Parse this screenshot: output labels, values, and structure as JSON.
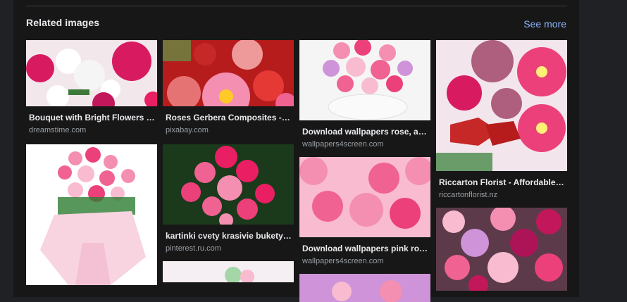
{
  "section": {
    "title": "Related images",
    "see_more": "See more"
  },
  "cards": [
    {
      "title": "Bouquet with Bright Flowers . ...",
      "source": "dreamstime.com"
    },
    {
      "title": "Roses Gerbera Composites - F...",
      "source": "pixabay.com"
    },
    {
      "title": "Download wallpapers rose, als...",
      "source": "wallpapers4screen.com"
    },
    {
      "title": "Riccarton Florist - Affordable F...",
      "source": "riccartonflorist.nz"
    },
    {
      "title": "",
      "source": ""
    },
    {
      "title": "kartinki cvety krasivie bukety 3...",
      "source": "pinterest.ru.com"
    },
    {
      "title": "Download wallpapers pink ros...",
      "source": "wallpapers4screen.com"
    },
    {
      "title": "",
      "source": ""
    }
  ]
}
